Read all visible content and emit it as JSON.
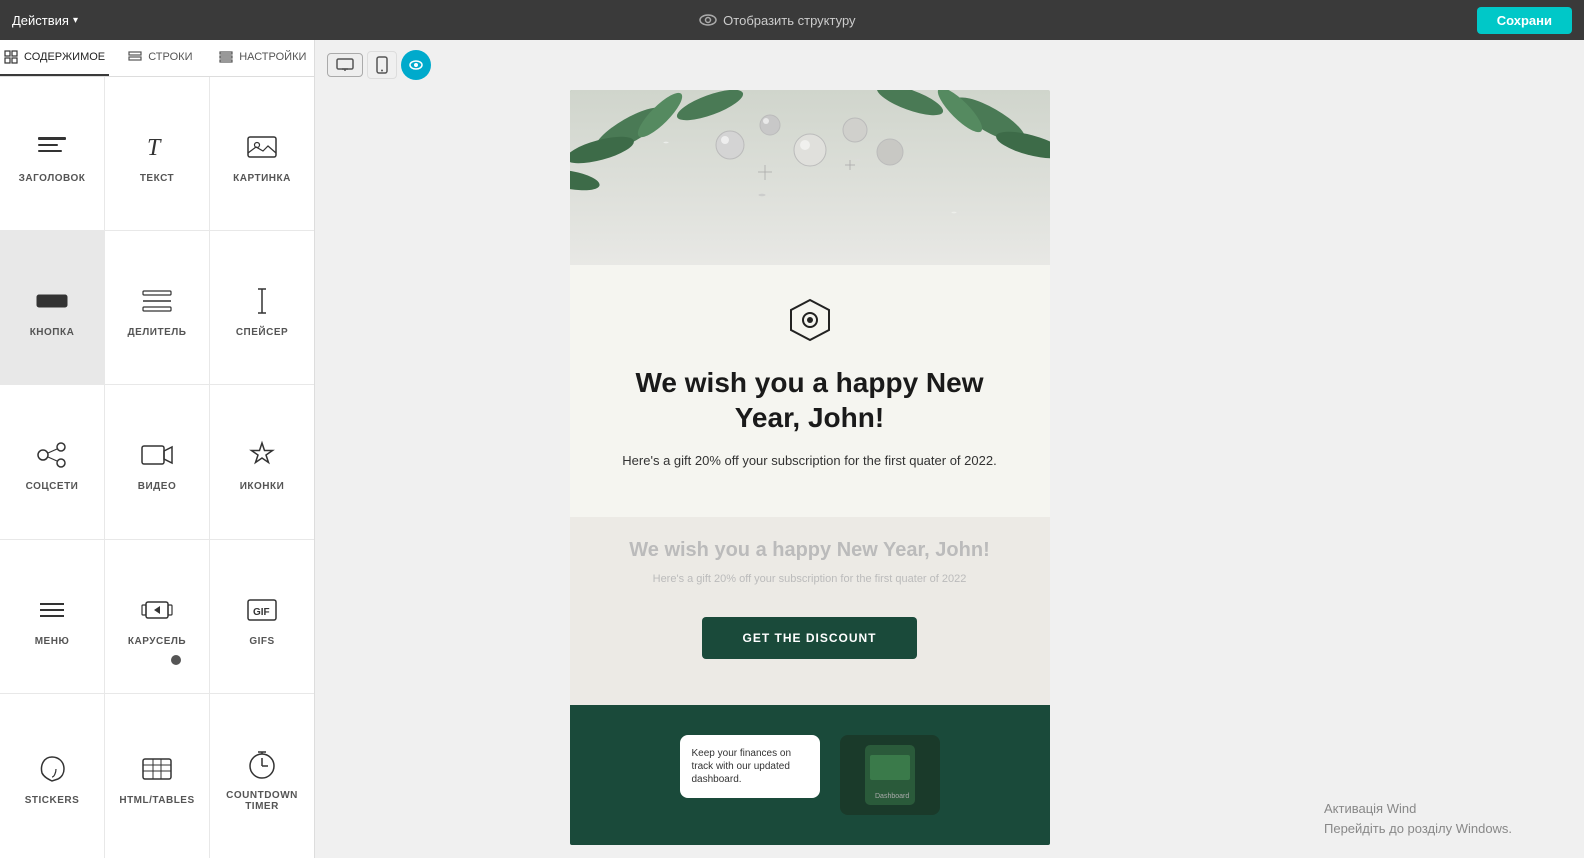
{
  "topbar": {
    "actions_label": "Действия",
    "display_structure_label": "Отобразить структуру",
    "save_label": "Сохрани"
  },
  "tabs": [
    {
      "id": "content",
      "label": "СОДЕРЖИМОЕ",
      "icon": "grid-icon"
    },
    {
      "id": "rows",
      "label": "СТРОКИ",
      "icon": "rows-icon"
    },
    {
      "id": "settings",
      "label": "НАСТРОЙКИ",
      "icon": "settings-icon"
    }
  ],
  "components": [
    {
      "id": "heading",
      "label": "ЗАГОЛОВОК",
      "icon": "heading"
    },
    {
      "id": "text",
      "label": "ТЕКСТ",
      "icon": "text"
    },
    {
      "id": "image",
      "label": "КАРТИНКА",
      "icon": "image"
    },
    {
      "id": "button",
      "label": "КНОПКА",
      "icon": "button",
      "active": true
    },
    {
      "id": "divider",
      "label": "ДЕЛИТЕЛЬ",
      "icon": "divider"
    },
    {
      "id": "spacer",
      "label": "СПЕЙСЕР",
      "icon": "spacer"
    },
    {
      "id": "social",
      "label": "СОЦСЕТИ",
      "icon": "social"
    },
    {
      "id": "video",
      "label": "ВИДЕО",
      "icon": "video"
    },
    {
      "id": "icons",
      "label": "ИКОНКИ",
      "icon": "icons"
    },
    {
      "id": "menu",
      "label": "МЕНЮ",
      "icon": "menu"
    },
    {
      "id": "carousel",
      "label": "КАРУСЕЛЬ",
      "icon": "carousel",
      "badge": true
    },
    {
      "id": "gifs",
      "label": "GIFS",
      "icon": "gifs"
    },
    {
      "id": "stickers",
      "label": "STICKERS",
      "icon": "stickers"
    },
    {
      "id": "html_tables",
      "label": "HTML/TABLES",
      "icon": "html"
    },
    {
      "id": "countdown",
      "label": "COUNTDOWN TIMER",
      "icon": "countdown"
    }
  ],
  "canvas": {
    "toolbar": {
      "desktop_label": "desktop",
      "tablet_label": "tablet",
      "preview_label": "preview"
    }
  },
  "email": {
    "heading": "We wish you a happy New Year, John!",
    "subtext": "Here's a gift 20% off your subscription for the first quater of 2022.",
    "ghost_heading": "We wish you a happy New Year, John!",
    "ghost_subtext": "Here's a gift 20% off your subscription for the first quater of 2022",
    "cta_label": "GET THE DISCOUNT",
    "footer_card_text": "Keep your finances on track with our updated dashboard."
  },
  "watermark": {
    "line1": "Активація Wind",
    "line2": "Перейдіть до розділу Windows."
  }
}
